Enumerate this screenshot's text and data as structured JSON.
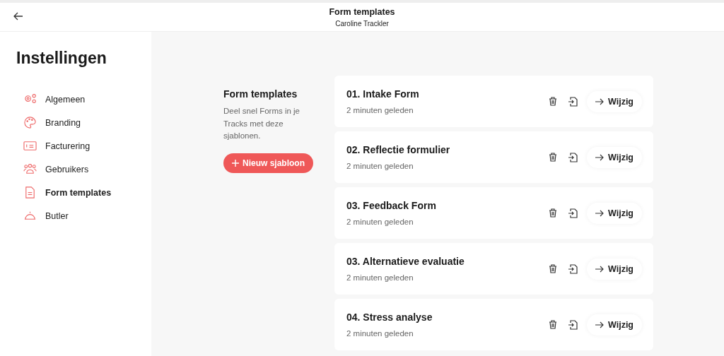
{
  "header": {
    "title": "Form templates",
    "subtitle": "Caroline Trackler"
  },
  "sidebar": {
    "title": "Instellingen",
    "items": [
      {
        "label": "Algemeen",
        "kind": "gears",
        "selected": false
      },
      {
        "label": "Branding",
        "kind": "palette",
        "selected": false
      },
      {
        "label": "Facturering",
        "kind": "invoice",
        "selected": false
      },
      {
        "label": "Gebruikers",
        "kind": "users",
        "selected": false
      },
      {
        "label": "Form templates",
        "kind": "document",
        "selected": true
      },
      {
        "label": "Butler",
        "kind": "bell",
        "selected": false
      }
    ]
  },
  "intro": {
    "title": "Form templates",
    "description": "Deel snel Forms in je Tracks met deze sjablonen.",
    "button": "Nieuw sjabloon"
  },
  "templates": [
    {
      "name": "01. Intake Form",
      "updated": "2 minuten geleden",
      "action": "Wijzig"
    },
    {
      "name": "02. Reflectie formulier",
      "updated": "2 minuten geleden",
      "action": "Wijzig"
    },
    {
      "name": "03. Feedback Form",
      "updated": "2 minuten geleden",
      "action": "Wijzig"
    },
    {
      "name": "03. Alternatieve evaluatie",
      "updated": "2 minuten geleden",
      "action": "Wijzig"
    },
    {
      "name": "04. Stress analyse",
      "updated": "2 minuten geleden",
      "action": "Wijzig"
    }
  ]
}
